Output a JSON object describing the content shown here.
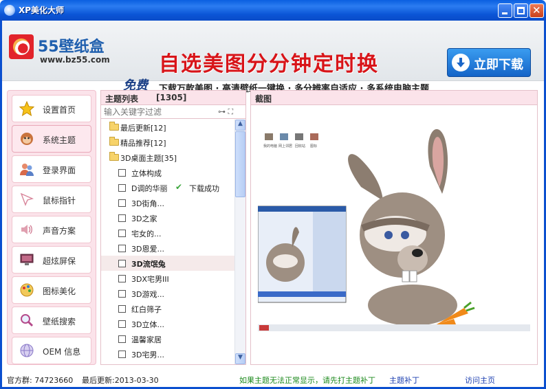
{
  "window": {
    "title": "XP美化大师"
  },
  "banner": {
    "logo_text": "55壁纸盒",
    "logo_url": "www.bz55.com",
    "slogan": "自选美图分分钟定时换",
    "free": "免费",
    "features": "下载万款美图 · 高清壁纸一键换  ·  多分辨率自适应  ·  多系统电脑主题",
    "download_button": "立即下载"
  },
  "sidebar": {
    "items": [
      {
        "label": "设置首页",
        "icon": "star-icon"
      },
      {
        "label": "系统主题",
        "icon": "monkey-icon"
      },
      {
        "label": "登录界面",
        "icon": "users-icon"
      },
      {
        "label": "鼠标指针",
        "icon": "cursor-icon"
      },
      {
        "label": "声音方案",
        "icon": "speaker-icon"
      },
      {
        "label": "超炫屏保",
        "icon": "screensaver-icon"
      },
      {
        "label": "图标美化",
        "icon": "palette-icon"
      },
      {
        "label": "壁纸搜索",
        "icon": "magnifier-icon"
      },
      {
        "label": "OEM 信息",
        "icon": "globe-icon"
      }
    ]
  },
  "theme_list": {
    "title": "主题列表",
    "count": "[1305]",
    "filter_placeholder": "输入关键字过滤",
    "folders": [
      {
        "label": "最后更新[12]"
      },
      {
        "label": "精品推荐[12]"
      },
      {
        "label": "3D桌面主题[35]"
      }
    ],
    "items": [
      {
        "label": "立体构成"
      },
      {
        "label": "D调的华丽",
        "status": "下载成功"
      },
      {
        "label": "3D街角..."
      },
      {
        "label": "3D之家"
      },
      {
        "label": "宅女的..."
      },
      {
        "label": "3D恩爱..."
      },
      {
        "label": "3D流氓兔",
        "selected": true
      },
      {
        "label": "3DX宅男III"
      },
      {
        "label": "3D游戏..."
      },
      {
        "label": "红白筛子"
      },
      {
        "label": "3D立体..."
      },
      {
        "label": "温馨家居"
      },
      {
        "label": "3D宅男..."
      }
    ]
  },
  "preview": {
    "title": "截图",
    "desktop_icons": [
      "我的电脑",
      "网上邻居",
      "回收站",
      "图标"
    ]
  },
  "status": {
    "group": "官方群: 74723660",
    "last_update": "最后更新:2013-03-30",
    "warning": "如果主题无法正常显示，请先打主题补丁",
    "patch_link": "主题补丁",
    "visit_link": "访问主页"
  }
}
